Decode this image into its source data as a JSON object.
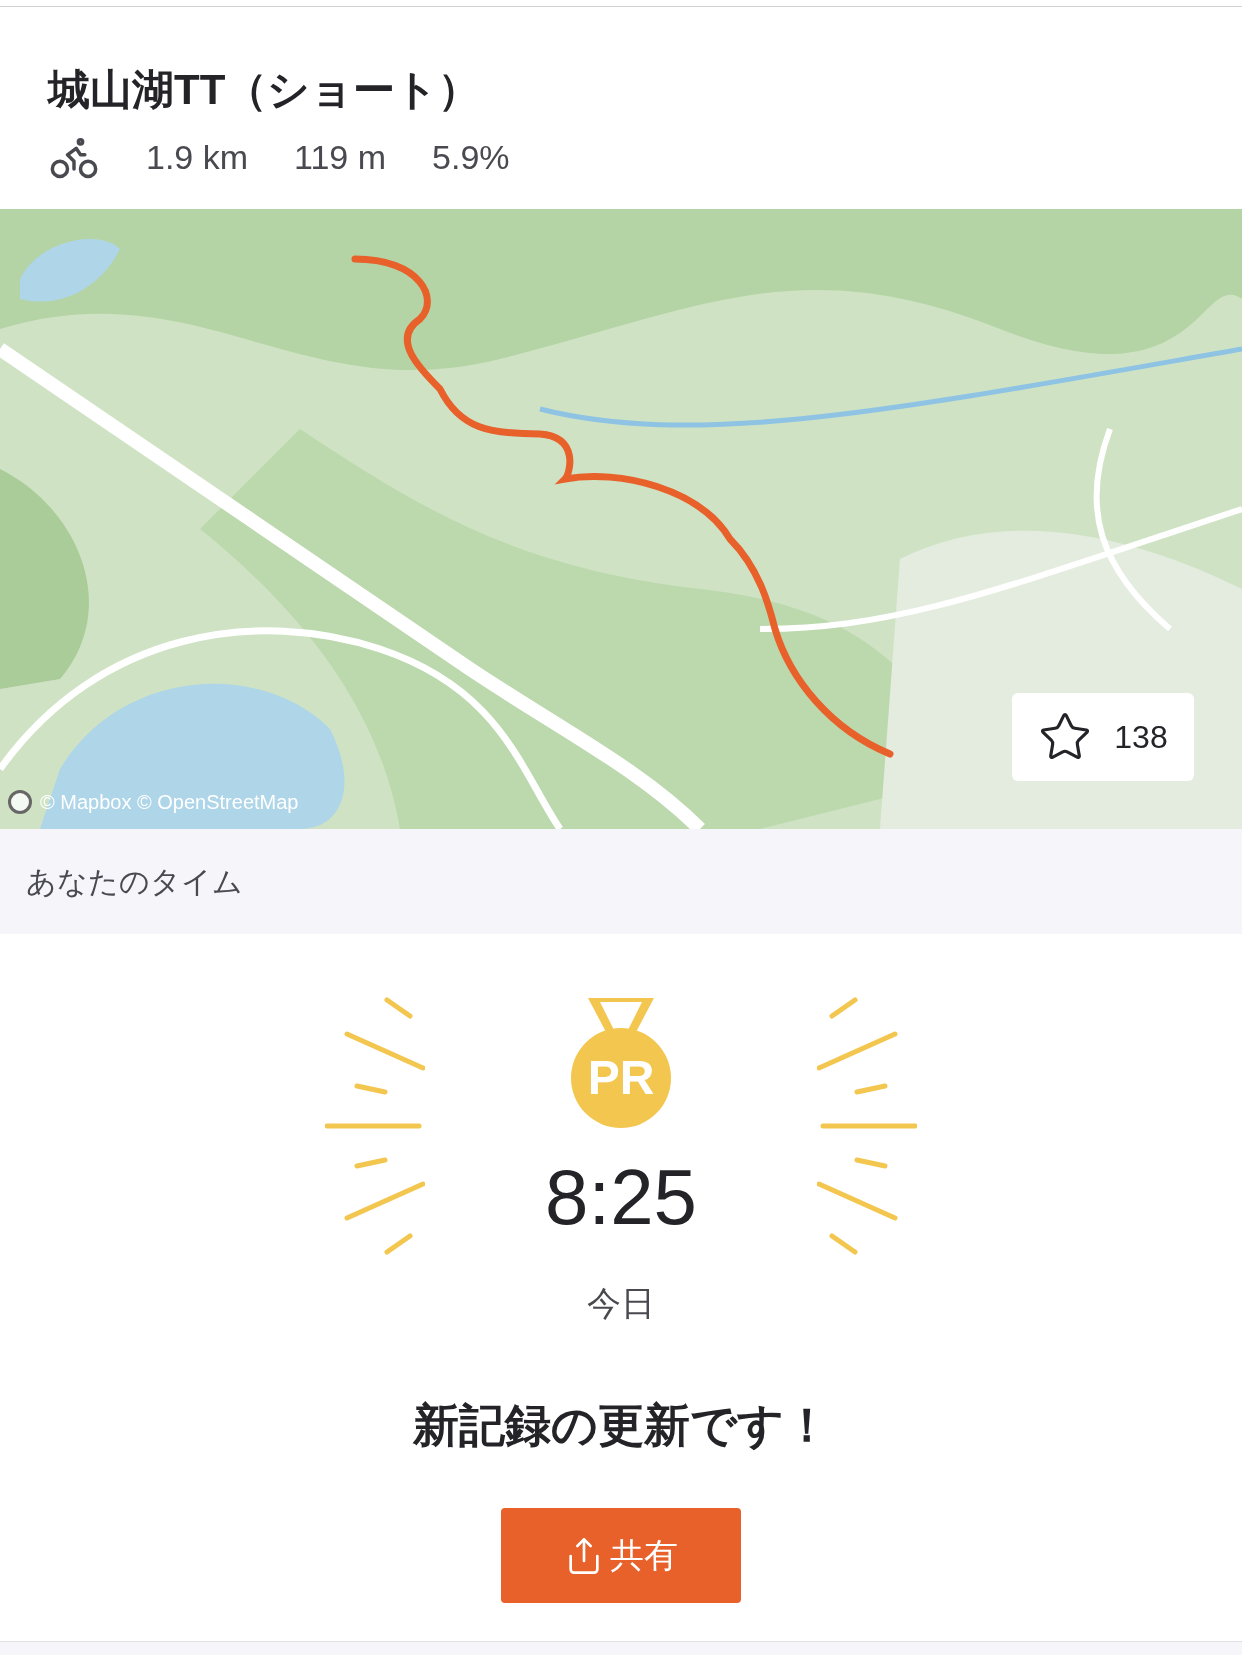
{
  "segment": {
    "title": "城山湖TT（ショート）",
    "distance": "1.9 km",
    "elevation": "119 m",
    "grade": "5.9%"
  },
  "map": {
    "kind": "picture",
    "attribution": "© Mapbox © OpenStreetMap",
    "star_count": "138",
    "starred": false
  },
  "your_time": {
    "header": "あなたのタイム",
    "badge": "PR",
    "time": "8:25",
    "date": "今日",
    "message": "新記録の更新です！",
    "share_label": "共有"
  }
}
